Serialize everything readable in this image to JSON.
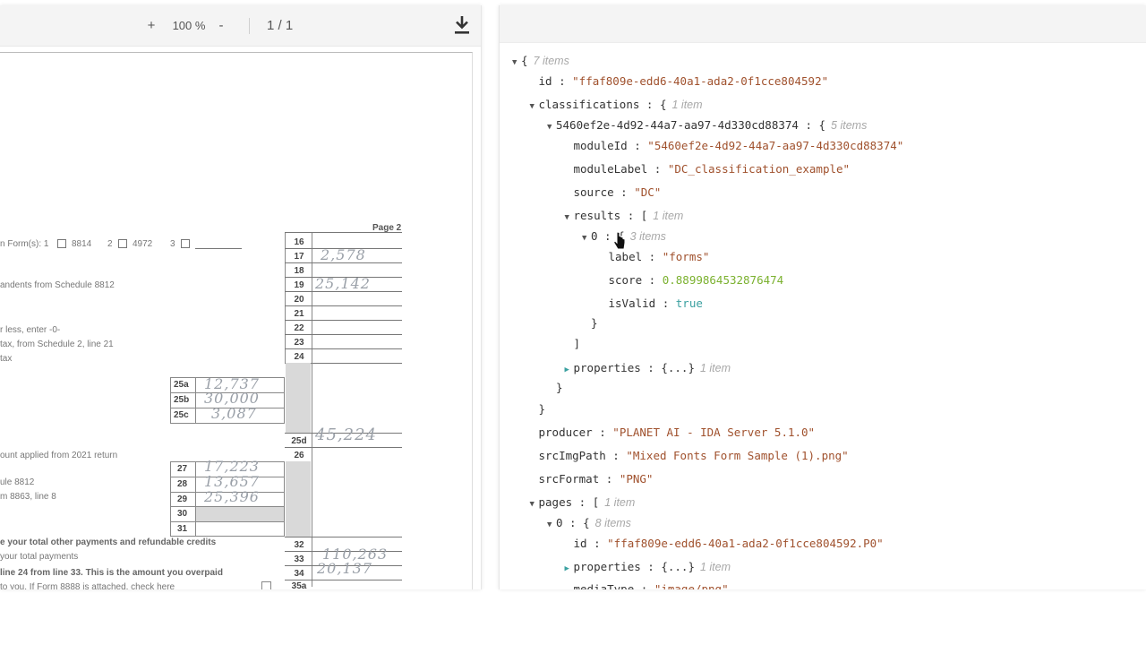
{
  "toolbar": {
    "zoom_in": "+",
    "zoom_level": "100 %",
    "zoom_out": "-",
    "page_indicator": "1 / 1"
  },
  "document": {
    "page_label": "Page 2",
    "top_row": {
      "text": "n Form(s): 1",
      "opt1": "8814",
      "opt2": "2",
      "opt3": "4972",
      "opt4": "3"
    },
    "lines": [
      {
        "num": "16",
        "label": ""
      },
      {
        "num": "17",
        "label": "",
        "hand": "2,578"
      },
      {
        "num": "18",
        "label": ""
      },
      {
        "num": "19",
        "label": "andents from Schedule 8812",
        "hand": "25,142"
      },
      {
        "num": "20",
        "label": ""
      },
      {
        "num": "21",
        "label": ""
      },
      {
        "num": "22",
        "label": "r less, enter -0-"
      },
      {
        "num": "23",
        "label": "tax, from Schedule 2, line 21"
      },
      {
        "num": "24",
        "label": "tax"
      }
    ],
    "sub25": [
      {
        "num": "25a",
        "hand": "12,737"
      },
      {
        "num": "25b",
        "hand": "30,000"
      },
      {
        "num": "25c",
        "hand": "3,087"
      }
    ],
    "line25d": {
      "num": "25d",
      "hand": "45,224"
    },
    "line26": {
      "num": "26",
      "label": "ount applied from 2021 return"
    },
    "sub27": [
      {
        "num": "27",
        "label": "",
        "hand": "17,223"
      },
      {
        "num": "28",
        "label": "ule 8812",
        "hand": "13,657"
      },
      {
        "num": "29",
        "label": "m 8863, line 8",
        "hand": "25,396"
      },
      {
        "num": "30",
        "label": ""
      },
      {
        "num": "31",
        "label": ""
      }
    ],
    "line32": {
      "num": "32",
      "label": "e your total other payments and refundable credits"
    },
    "line33": {
      "num": "33",
      "label": "your total payments",
      "hand": "110,263"
    },
    "line34": {
      "num": "34",
      "label": "line 24 from line 33. This is the amount you overpaid",
      "hand": "20,137"
    },
    "line35": {
      "num": "35a",
      "label": "to you. If Form 8888 is attached, check here"
    }
  },
  "json_tree": [
    {
      "indent": 0,
      "toggle": "open",
      "key": "",
      "open": "{",
      "meta": "7 items"
    },
    {
      "indent": 1,
      "key": "id",
      "value": "\"ffaf809e-edd6-40a1-ada2-0f1cce804592\"",
      "vtype": "string"
    },
    {
      "indent": 1,
      "toggle": "open",
      "key": "classifications",
      "open": "{",
      "meta": "1 item"
    },
    {
      "indent": 2,
      "toggle": "open",
      "key": "5460ef2e-4d92-44a7-aa97-4d330cd88374",
      "open": "{",
      "meta": "5 items"
    },
    {
      "indent": 3,
      "key": "moduleId",
      "value": "\"5460ef2e-4d92-44a7-aa97-4d330cd88374\"",
      "vtype": "string"
    },
    {
      "indent": 3,
      "key": "moduleLabel",
      "value": "\"DC_classification_example\"",
      "vtype": "string"
    },
    {
      "indent": 3,
      "key": "source",
      "value": "\"DC\"",
      "vtype": "string"
    },
    {
      "indent": 3,
      "toggle": "open",
      "key": "results",
      "open": "[",
      "meta": "1 item"
    },
    {
      "indent": 4,
      "toggle": "open",
      "key": "0",
      "open": "{",
      "meta": "3 items"
    },
    {
      "indent": 5,
      "key": "label",
      "value": "\"forms\"",
      "vtype": "string"
    },
    {
      "indent": 5,
      "key": "score",
      "value": "0.8899864532876474",
      "vtype": "number"
    },
    {
      "indent": 5,
      "key": "isValid",
      "value": "true",
      "vtype": "bool"
    },
    {
      "indent": 4,
      "close": "}"
    },
    {
      "indent": 3,
      "close": "]"
    },
    {
      "indent": 3,
      "toggle": "closed",
      "key": "properties",
      "open": "{...}",
      "meta": "1 item"
    },
    {
      "indent": 2,
      "close": "}"
    },
    {
      "indent": 1,
      "close": "}"
    },
    {
      "indent": 1,
      "key": "producer",
      "value": "\"PLANET AI - IDA Server 5.1.0\"",
      "vtype": "string"
    },
    {
      "indent": 1,
      "key": "srcImgPath",
      "value": "\"Mixed Fonts Form Sample (1).png\"",
      "vtype": "string"
    },
    {
      "indent": 1,
      "key": "srcFormat",
      "value": "\"PNG\"",
      "vtype": "string"
    },
    {
      "indent": 1,
      "toggle": "open",
      "key": "pages",
      "open": "[",
      "meta": "1 item"
    },
    {
      "indent": 2,
      "toggle": "open",
      "key": "0",
      "open": "{",
      "meta": "8 items"
    },
    {
      "indent": 3,
      "key": "id",
      "value": "\"ffaf809e-edd6-40a1-ada2-0f1cce804592.P0\"",
      "vtype": "string"
    },
    {
      "indent": 3,
      "toggle": "closed",
      "key": "properties",
      "open": "{...}",
      "meta": "1 item"
    },
    {
      "indent": 3,
      "key": "mediaType",
      "value": "\"image/png\"",
      "vtype": "string"
    }
  ],
  "icons": {
    "download": "download-icon",
    "expand": "caret-down-icon",
    "collapse": "caret-right-icon",
    "cursor": "mouse-pointer-icon"
  },
  "colors": {
    "string": "#a0512d",
    "number": "#7bb12f",
    "boolean": "#3aa0a0",
    "meta": "#a8a8a8"
  }
}
